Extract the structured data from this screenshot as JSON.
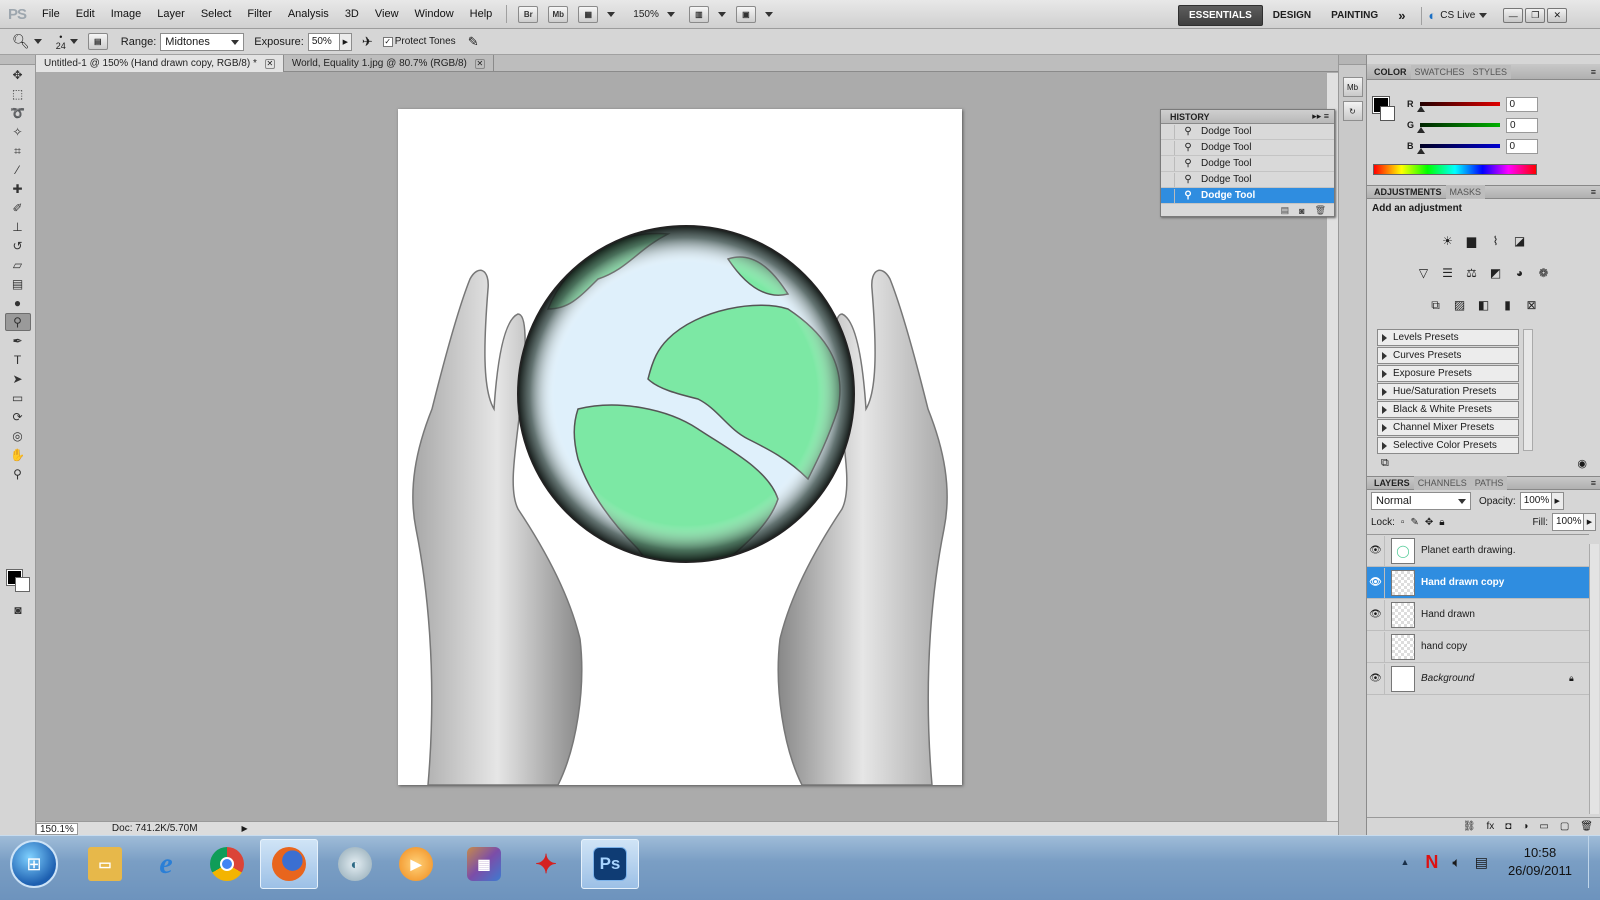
{
  "app": {
    "logo": "PS"
  },
  "menu": [
    "File",
    "Edit",
    "Image",
    "Layer",
    "Select",
    "Filter",
    "Analysis",
    "3D",
    "View",
    "Window",
    "Help"
  ],
  "menubar": {
    "bridge": "Br",
    "minibridge": "Mb",
    "zoom": "150%",
    "workspaces": [
      "ESSENTIALS",
      "DESIGN",
      "PAINTING"
    ],
    "more": "»",
    "cslive": "CS Live"
  },
  "options": {
    "brush_size": "24",
    "range_label": "Range:",
    "range_value": "Midtones",
    "exposure_label": "Exposure:",
    "exposure_value": "50%",
    "protect_tones": "Protect Tones"
  },
  "tabs": [
    {
      "title": "Untitled-1 @ 150% (Hand drawn copy, RGB/8) *",
      "active": true
    },
    {
      "title": "World, Equality 1.jpg @ 80.7% (RGB/8)",
      "active": false
    }
  ],
  "status": {
    "zoom": "150.1%",
    "doc": "Doc: 741.2K/5.70M"
  },
  "history": {
    "title": "HISTORY",
    "items": [
      "Dodge Tool",
      "Dodge Tool",
      "Dodge Tool",
      "Dodge Tool",
      "Dodge Tool"
    ],
    "active_index": 4
  },
  "color_panel": {
    "tabs": [
      "COLOR",
      "SWATCHES",
      "STYLES"
    ],
    "channels": [
      {
        "label": "R",
        "value": "0",
        "color": "#e00000"
      },
      {
        "label": "G",
        "value": "0",
        "color": "#00b000"
      },
      {
        "label": "B",
        "value": "0",
        "color": "#0000d0"
      }
    ]
  },
  "adjustments": {
    "tabs": [
      "ADJUSTMENTS",
      "MASKS"
    ],
    "heading": "Add an adjustment",
    "presets": [
      "Levels Presets",
      "Curves Presets",
      "Exposure Presets",
      "Hue/Saturation Presets",
      "Black & White Presets",
      "Channel Mixer Presets",
      "Selective Color Presets"
    ]
  },
  "layers_panel": {
    "tabs": [
      "LAYERS",
      "CHANNELS",
      "PATHS"
    ],
    "blend_mode": "Normal",
    "opacity_label": "Opacity:",
    "opacity": "100%",
    "lock_label": "Lock:",
    "fill_label": "Fill:",
    "fill": "100%",
    "layers": [
      {
        "name": "Planet earth drawing.",
        "visible": true,
        "active": false
      },
      {
        "name": "Hand drawn copy",
        "visible": true,
        "active": true
      },
      {
        "name": "Hand drawn",
        "visible": true,
        "active": false
      },
      {
        "name": "hand copy",
        "visible": false,
        "active": false
      },
      {
        "name": "Background",
        "visible": true,
        "active": false,
        "locked": true
      }
    ]
  },
  "taskbar": {
    "time": "10:58",
    "date": "26/09/2011",
    "apps": [
      "windows-explorer",
      "internet-explorer",
      "chrome",
      "firefox",
      "app-5",
      "media-player",
      "image-viewer",
      "sbp-app",
      "photoshop"
    ]
  },
  "colors": {
    "accent": "#2f8de0",
    "globe_land": "#7ce8a4",
    "globe_ocean": "#dff0fb"
  }
}
